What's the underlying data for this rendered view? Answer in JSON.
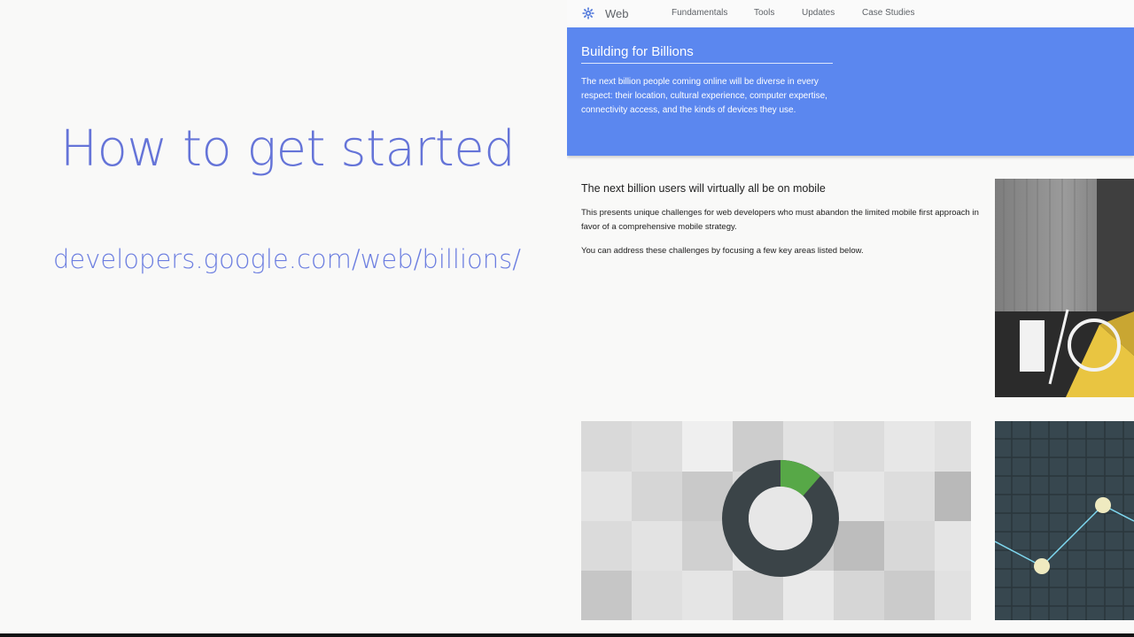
{
  "slide": {
    "title": "How to get started",
    "url": "developers.google.com/web/billions/"
  },
  "site": {
    "brand": "Web",
    "brand_icon": "web-fundamentals-icon",
    "nav": [
      "Fundamentals",
      "Tools",
      "Updates",
      "Case Studies"
    ],
    "hero": {
      "title": "Building for Billions",
      "body": "The next billion people coming online will be diverse in every respect: their location, cultural experience, computer expertise, connectivity access, and the kinds of devices they use."
    },
    "section": {
      "heading": "The next billion users will virtually all be on mobile",
      "p1": "This presents unique challenges for web developers who must abandon the limited mobile first approach in favor of a comprehensive mobile strategy.",
      "p2": "You can address these challenges by focusing a few key areas listed below."
    },
    "cards": {
      "video_icon": "google-io-logo-icon",
      "pixel_icon": "donut-progress-icon",
      "graph_icon": "line-graph-icon"
    }
  },
  "colors": {
    "slide_accent": "#6574d8",
    "hero_bg": "#5b87ef",
    "donut_dark": "#37474f",
    "donut_green": "#57a847",
    "graph_bg": "#37474f",
    "graph_line": "#7fd7ef",
    "graph_point": "#efeac0"
  }
}
